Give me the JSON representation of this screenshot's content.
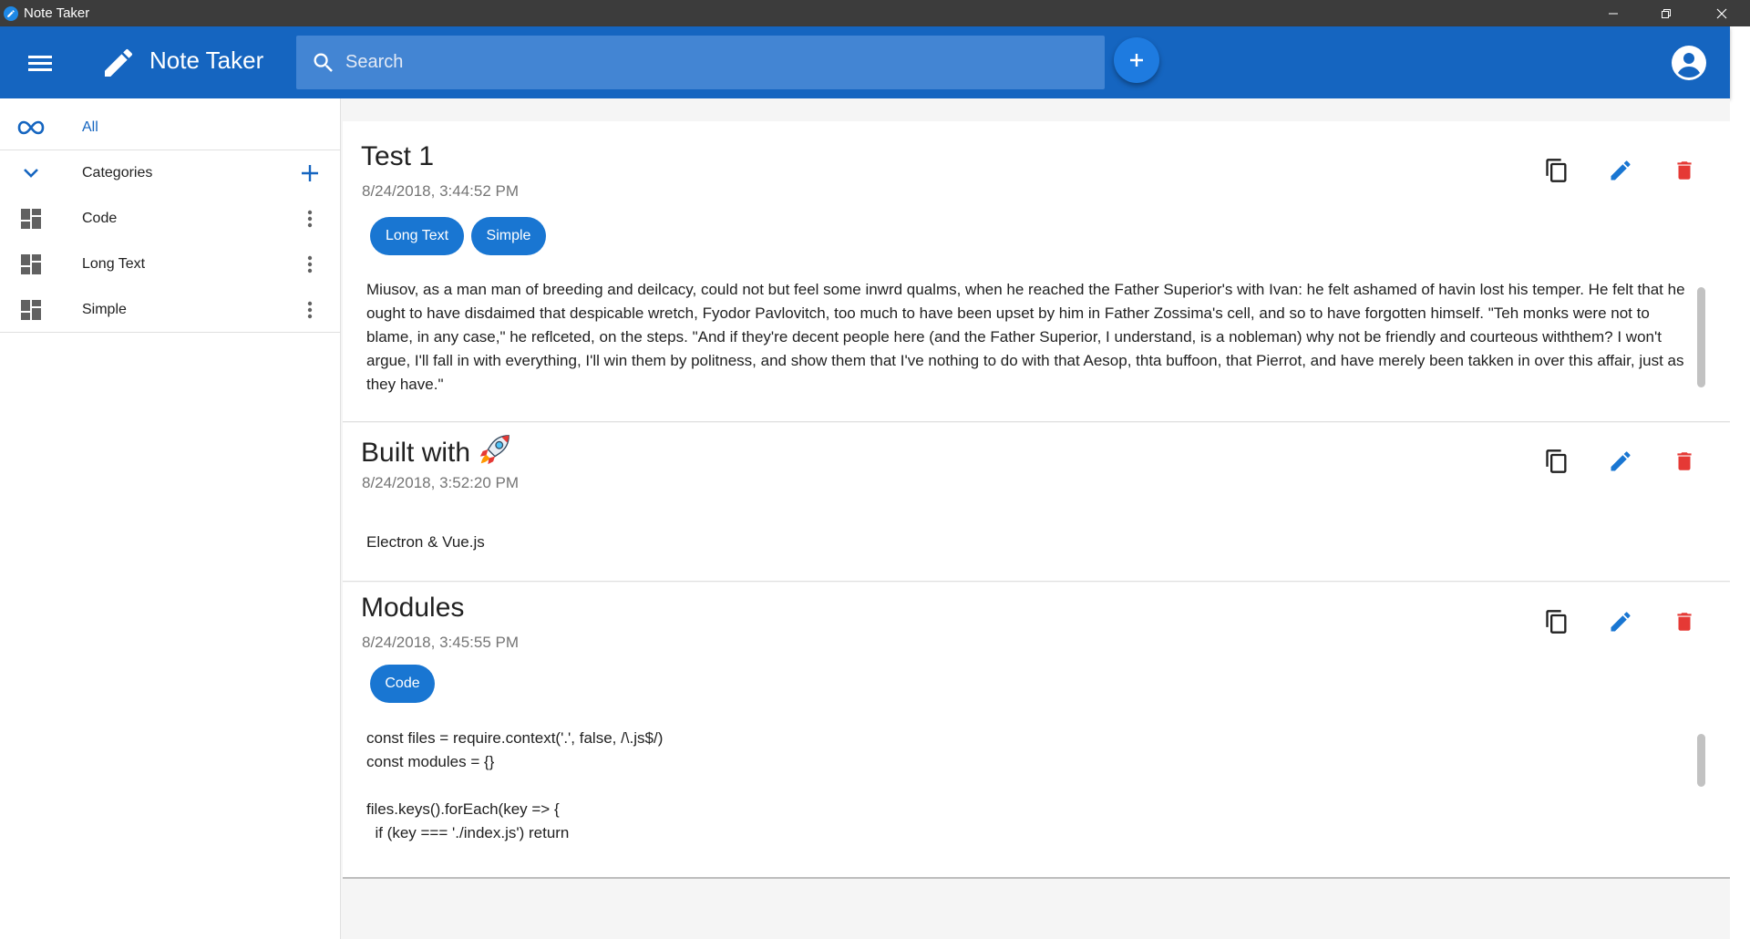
{
  "window": {
    "title": "Note Taker"
  },
  "appbar": {
    "title": "Note Taker",
    "search_placeholder": "Search",
    "primary_color": "#1565c0"
  },
  "sidebar": {
    "all_label": "All",
    "categories_label": "Categories",
    "categories": [
      {
        "label": "Code"
      },
      {
        "label": "Long Text"
      },
      {
        "label": "Simple"
      }
    ]
  },
  "notes": [
    {
      "title": "Test 1",
      "date": "8/24/2018, 3:44:52 PM",
      "tags": [
        "Long Text",
        "Simple"
      ],
      "body": "Miusov, as a man man of breeding and deilcacy, could not but feel some inwrd qualms, when he reached the Father Superior's with Ivan: he felt ashamed of havin lost his temper. He felt that he ought to have disdaimed that despicable wretch, Fyodor Pavlovitch, too much to have been upset by him in Father Zossima's cell, and so to have forgotten himself. \"Teh monks were not to blame, in any case,\" he reflceted, on the steps. \"And if they're decent people here (and the Father Superior, I understand, is a nobleman) why not be friendly and courteous withthem? I won't argue, I'll fall in with everything, I'll win them by politness, and show them that I've nothing to do with that Aesop, thta buffoon, that Pierrot, and have merely been takken in over this affair, just as they have.\""
    },
    {
      "title": "Built with",
      "title_emoji": "rocket",
      "date": "8/24/2018, 3:52:20 PM",
      "tags": [],
      "body": "Electron & Vue.js"
    },
    {
      "title": "Modules",
      "date": "8/24/2018, 3:45:55 PM",
      "tags": [
        "Code"
      ],
      "body": "const files = require.context('.', false, /\\.js$/)\nconst modules = {}\n\nfiles.keys().forEach(key => {\n  if (key === './index.js') return"
    }
  ],
  "colors": {
    "chip": "#1976d2",
    "delete": "#e53935",
    "edit": "#1976d2"
  }
}
